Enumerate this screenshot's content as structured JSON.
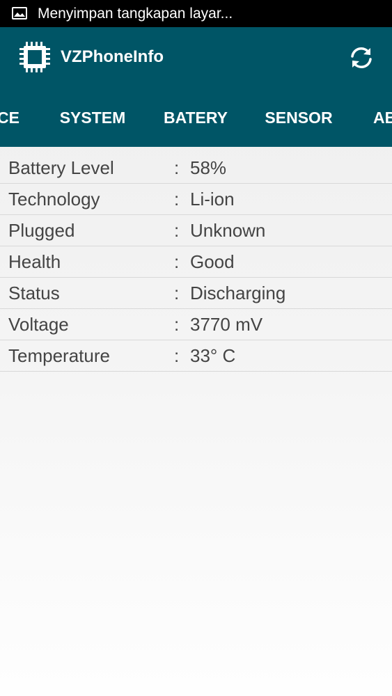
{
  "status_bar": {
    "icon": "image-icon",
    "text": "Menyimpan tangkapan layar..."
  },
  "app_bar": {
    "logo_icon": "chip-icon",
    "title": "VZPhoneInfo",
    "refresh_icon": "refresh-icon"
  },
  "colors": {
    "app_bar_bg": "#005566",
    "status_bar_bg": "#000000",
    "tab_indicator": "#ffffff",
    "text": "#444444"
  },
  "tabs": [
    {
      "label": "CE"
    },
    {
      "label": "SYSTEM"
    },
    {
      "label": "BATERY",
      "selected": true
    },
    {
      "label": "SENSOR"
    },
    {
      "label": "AB"
    }
  ],
  "separator": ":",
  "battery_info": [
    {
      "label": "Battery Level",
      "value": "58%"
    },
    {
      "label": "Technology",
      "value": "Li-ion"
    },
    {
      "label": "Plugged",
      "value": "Unknown"
    },
    {
      "label": "Health",
      "value": "Good"
    },
    {
      "label": "Status",
      "value": "Discharging"
    },
    {
      "label": "Voltage",
      "value": "3770 mV"
    },
    {
      "label": "Temperature",
      "value": "33° C"
    }
  ]
}
